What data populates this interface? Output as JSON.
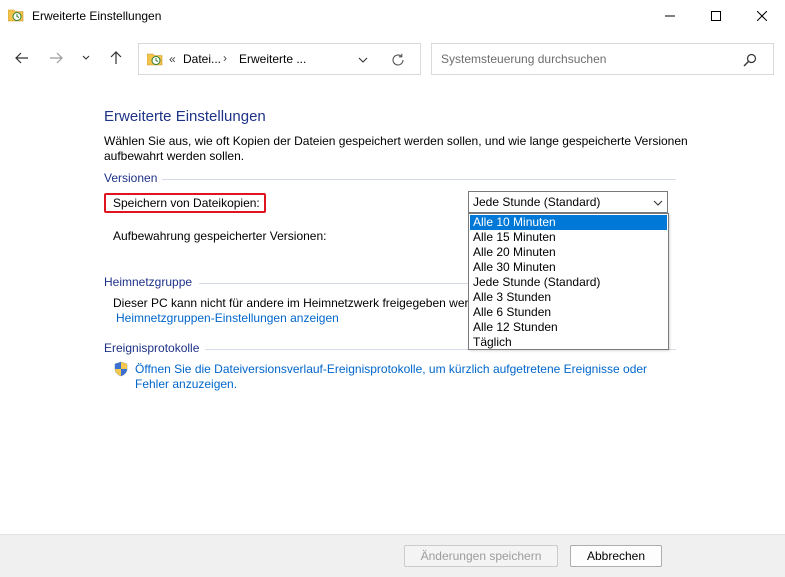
{
  "window": {
    "title": "Erweiterte Einstellungen",
    "icon": "file-history-icon"
  },
  "nav": {
    "breadcrumb_prefix": "«",
    "crumbs": [
      "Datei...",
      "Erweiterte ..."
    ],
    "separator": "›",
    "search_placeholder": "Systemsteuerung durchsuchen"
  },
  "main": {
    "title": "Erweiterte Einstellungen",
    "intro": "Wählen Sie aus, wie oft Kopien der Dateien gespeichert werden sollen, und wie lange gespeicherte Versionen aufbewahrt werden sollen.",
    "versions": {
      "header": "Versionen",
      "save_label": "Speichern von Dateikopien:",
      "retention_label": "Aufbewahrung gespeicherter Versionen:",
      "save_select_value": "Jede Stunde (Standard)",
      "options": [
        "Alle 10 Minuten",
        "Alle 15 Minuten",
        "Alle 20 Minuten",
        "Alle 30 Minuten",
        "Jede Stunde (Standard)",
        "Alle 3 Stunden",
        "Alle 6 Stunden",
        "Alle 12 Stunden",
        "Täglich"
      ],
      "highlighted_option_index": 0
    },
    "homegroup": {
      "header": "Heimnetzgruppe",
      "text": "Dieser PC kann nicht für andere im Heimnetzwerk freigegeben werden.",
      "link": "Heimnetzgruppen-Einstellungen anzeigen"
    },
    "eventlogs": {
      "header": "Ereignisprotokolle",
      "link": "Öffnen Sie die Dateiversionsverlauf-Ereignisprotokolle, um kürzlich aufgetretene Ereignisse oder Fehler anzuzeigen."
    }
  },
  "footer": {
    "save_label": "Änderungen speichern",
    "cancel_label": "Abbrechen"
  },
  "colors": {
    "accent": "#0078d7",
    "heading": "#1e3287",
    "link": "#0066cc",
    "highlight_box": "#e0141e"
  }
}
